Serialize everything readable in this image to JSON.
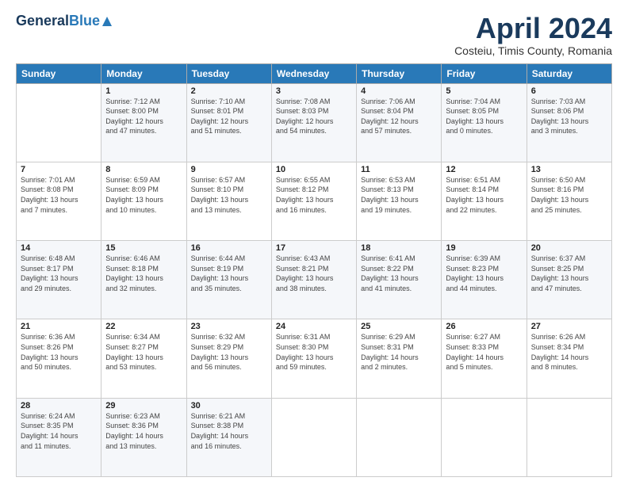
{
  "header": {
    "logo_general": "General",
    "logo_blue": "Blue",
    "month_title": "April 2024",
    "location": "Costeiu, Timis County, Romania"
  },
  "weekdays": [
    "Sunday",
    "Monday",
    "Tuesday",
    "Wednesday",
    "Thursday",
    "Friday",
    "Saturday"
  ],
  "weeks": [
    [
      {
        "day": "",
        "info": ""
      },
      {
        "day": "1",
        "info": "Sunrise: 7:12 AM\nSunset: 8:00 PM\nDaylight: 12 hours\nand 47 minutes."
      },
      {
        "day": "2",
        "info": "Sunrise: 7:10 AM\nSunset: 8:01 PM\nDaylight: 12 hours\nand 51 minutes."
      },
      {
        "day": "3",
        "info": "Sunrise: 7:08 AM\nSunset: 8:03 PM\nDaylight: 12 hours\nand 54 minutes."
      },
      {
        "day": "4",
        "info": "Sunrise: 7:06 AM\nSunset: 8:04 PM\nDaylight: 12 hours\nand 57 minutes."
      },
      {
        "day": "5",
        "info": "Sunrise: 7:04 AM\nSunset: 8:05 PM\nDaylight: 13 hours\nand 0 minutes."
      },
      {
        "day": "6",
        "info": "Sunrise: 7:03 AM\nSunset: 8:06 PM\nDaylight: 13 hours\nand 3 minutes."
      }
    ],
    [
      {
        "day": "7",
        "info": "Sunrise: 7:01 AM\nSunset: 8:08 PM\nDaylight: 13 hours\nand 7 minutes."
      },
      {
        "day": "8",
        "info": "Sunrise: 6:59 AM\nSunset: 8:09 PM\nDaylight: 13 hours\nand 10 minutes."
      },
      {
        "day": "9",
        "info": "Sunrise: 6:57 AM\nSunset: 8:10 PM\nDaylight: 13 hours\nand 13 minutes."
      },
      {
        "day": "10",
        "info": "Sunrise: 6:55 AM\nSunset: 8:12 PM\nDaylight: 13 hours\nand 16 minutes."
      },
      {
        "day": "11",
        "info": "Sunrise: 6:53 AM\nSunset: 8:13 PM\nDaylight: 13 hours\nand 19 minutes."
      },
      {
        "day": "12",
        "info": "Sunrise: 6:51 AM\nSunset: 8:14 PM\nDaylight: 13 hours\nand 22 minutes."
      },
      {
        "day": "13",
        "info": "Sunrise: 6:50 AM\nSunset: 8:16 PM\nDaylight: 13 hours\nand 25 minutes."
      }
    ],
    [
      {
        "day": "14",
        "info": "Sunrise: 6:48 AM\nSunset: 8:17 PM\nDaylight: 13 hours\nand 29 minutes."
      },
      {
        "day": "15",
        "info": "Sunrise: 6:46 AM\nSunset: 8:18 PM\nDaylight: 13 hours\nand 32 minutes."
      },
      {
        "day": "16",
        "info": "Sunrise: 6:44 AM\nSunset: 8:19 PM\nDaylight: 13 hours\nand 35 minutes."
      },
      {
        "day": "17",
        "info": "Sunrise: 6:43 AM\nSunset: 8:21 PM\nDaylight: 13 hours\nand 38 minutes."
      },
      {
        "day": "18",
        "info": "Sunrise: 6:41 AM\nSunset: 8:22 PM\nDaylight: 13 hours\nand 41 minutes."
      },
      {
        "day": "19",
        "info": "Sunrise: 6:39 AM\nSunset: 8:23 PM\nDaylight: 13 hours\nand 44 minutes."
      },
      {
        "day": "20",
        "info": "Sunrise: 6:37 AM\nSunset: 8:25 PM\nDaylight: 13 hours\nand 47 minutes."
      }
    ],
    [
      {
        "day": "21",
        "info": "Sunrise: 6:36 AM\nSunset: 8:26 PM\nDaylight: 13 hours\nand 50 minutes."
      },
      {
        "day": "22",
        "info": "Sunrise: 6:34 AM\nSunset: 8:27 PM\nDaylight: 13 hours\nand 53 minutes."
      },
      {
        "day": "23",
        "info": "Sunrise: 6:32 AM\nSunset: 8:29 PM\nDaylight: 13 hours\nand 56 minutes."
      },
      {
        "day": "24",
        "info": "Sunrise: 6:31 AM\nSunset: 8:30 PM\nDaylight: 13 hours\nand 59 minutes."
      },
      {
        "day": "25",
        "info": "Sunrise: 6:29 AM\nSunset: 8:31 PM\nDaylight: 14 hours\nand 2 minutes."
      },
      {
        "day": "26",
        "info": "Sunrise: 6:27 AM\nSunset: 8:33 PM\nDaylight: 14 hours\nand 5 minutes."
      },
      {
        "day": "27",
        "info": "Sunrise: 6:26 AM\nSunset: 8:34 PM\nDaylight: 14 hours\nand 8 minutes."
      }
    ],
    [
      {
        "day": "28",
        "info": "Sunrise: 6:24 AM\nSunset: 8:35 PM\nDaylight: 14 hours\nand 11 minutes."
      },
      {
        "day": "29",
        "info": "Sunrise: 6:23 AM\nSunset: 8:36 PM\nDaylight: 14 hours\nand 13 minutes."
      },
      {
        "day": "30",
        "info": "Sunrise: 6:21 AM\nSunset: 8:38 PM\nDaylight: 14 hours\nand 16 minutes."
      },
      {
        "day": "",
        "info": ""
      },
      {
        "day": "",
        "info": ""
      },
      {
        "day": "",
        "info": ""
      },
      {
        "day": "",
        "info": ""
      }
    ]
  ]
}
